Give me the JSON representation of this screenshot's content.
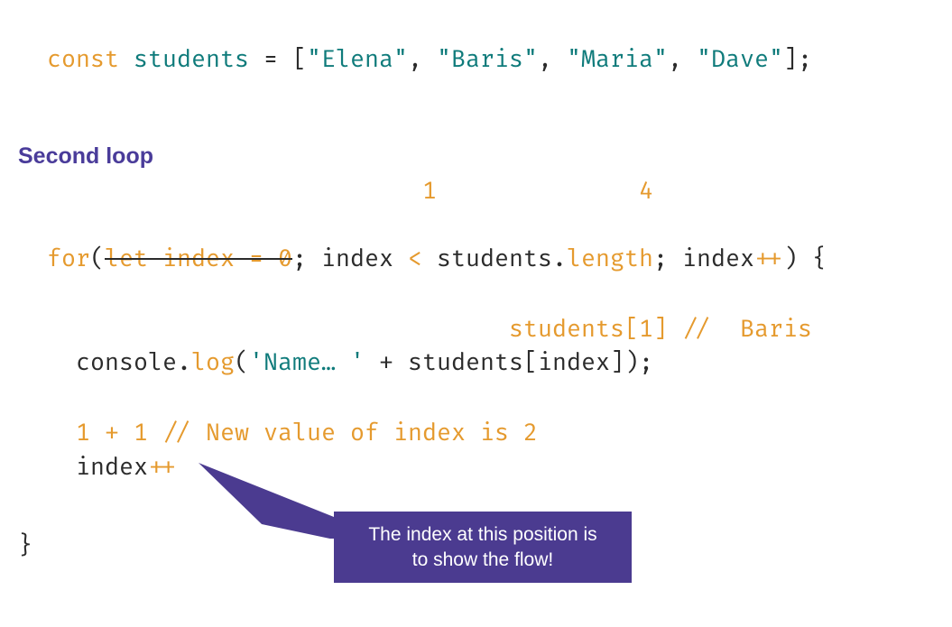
{
  "line1": {
    "const": "const",
    "sp1": " ",
    "students": "students",
    "eq": " = [",
    "s1": "\"Elena\"",
    "c1": ", ",
    "s2": "\"Baris\"",
    "c2": ", ",
    "s3": "\"Maria\"",
    "c3": ", ",
    "s4": "\"Dave\"",
    "end": "];"
  },
  "heading": "Second loop",
  "annot_top": {
    "pad": "                            ",
    "v1": "1",
    "mid": "              ",
    "v2": "4"
  },
  "forline": {
    "for": "for",
    "open": "(",
    "struck": "let index = 0",
    "semi1": "; index ",
    "lt": "<",
    "mid": " students.",
    "length": "length",
    "semi2": "; index",
    "plusplus": "++",
    "close": ") {"
  },
  "annot_students": {
    "pad": "                                  ",
    "txt": "students[1] //  Baris"
  },
  "logline": {
    "pad": "    ",
    "console": "console.",
    "log": "log",
    "open": "(",
    "str": "'Name… '",
    "plus": " + students[index]);"
  },
  "annot_newval": {
    "pad": "    ",
    "txt": "1 + 1 // New value of index is 2"
  },
  "idxpp": {
    "pad": "    ",
    "index": "index",
    "pp": "++"
  },
  "closebrace": "}",
  "callout": {
    "line1": "The index at this position is",
    "line2": "to show the flow!"
  }
}
